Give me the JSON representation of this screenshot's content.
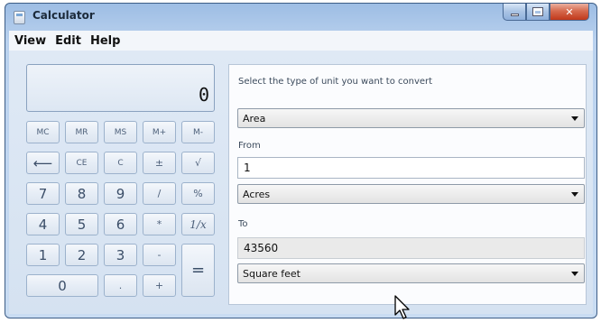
{
  "window": {
    "title": "Calculator"
  },
  "menu": [
    "View",
    "Edit",
    "Help"
  ],
  "display": {
    "value": "0"
  },
  "keys": {
    "mc": "MC",
    "mr": "MR",
    "ms": "MS",
    "mplus": "M+",
    "mminus": "M-",
    "backspace": "⟵",
    "ce": "CE",
    "c": "C",
    "plusminus": "±",
    "sqrt": "√",
    "n7": "7",
    "n8": "8",
    "n9": "9",
    "divide": "/",
    "percent": "%",
    "n4": "4",
    "n5": "5",
    "n6": "6",
    "multiply": "*",
    "reciprocal": "1/x",
    "n1": "1",
    "n2": "2",
    "n3": "3",
    "minus": "-",
    "equals": "=",
    "n0": "0",
    "decimal": ".",
    "plus": "+"
  },
  "converter": {
    "prompt": "Select the type of unit you want to convert",
    "unit_type": "Area",
    "from_label": "From",
    "from_value": "1",
    "from_unit": "Acres",
    "to_label": "To",
    "to_value": "43560",
    "to_unit": "Square feet"
  },
  "colors": {
    "titlebar": "#b9d1ee",
    "close_button": "#c0391b",
    "client_bg": "#d5e2f1"
  }
}
